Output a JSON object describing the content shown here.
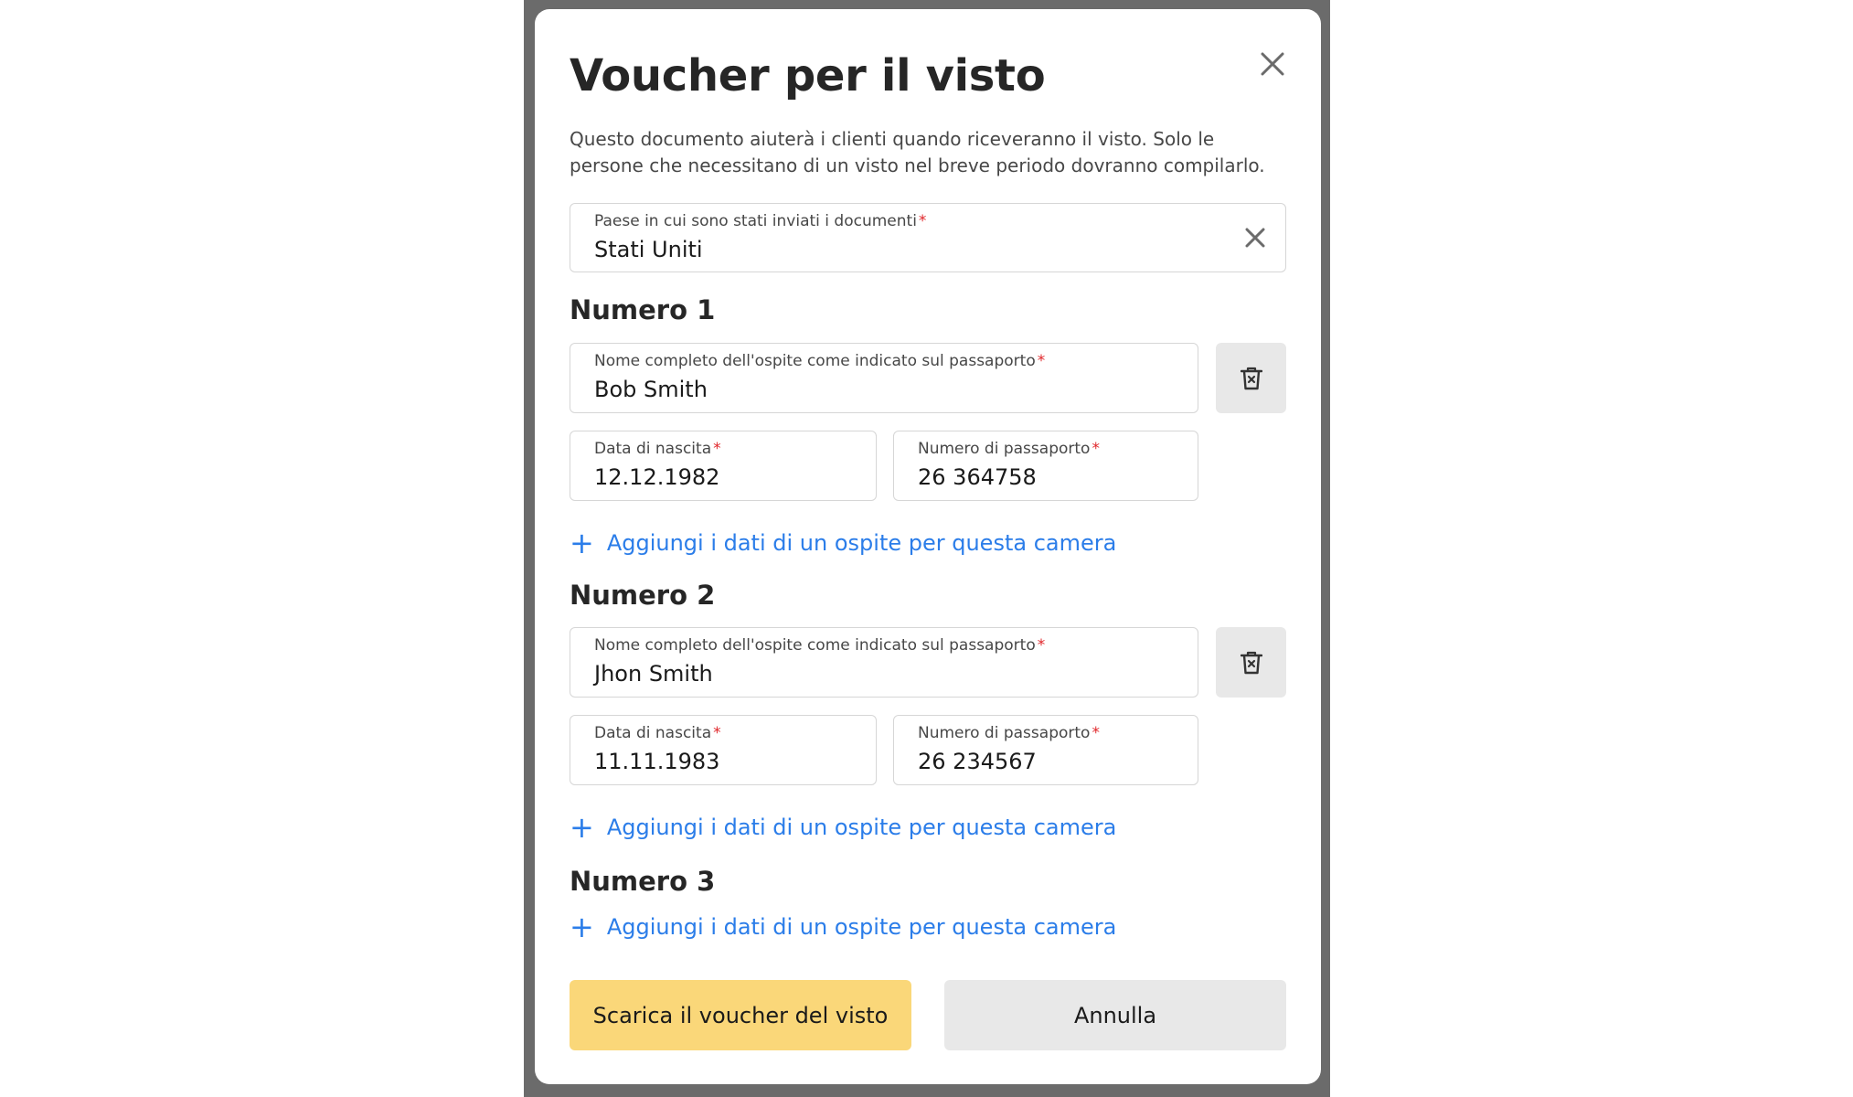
{
  "modal": {
    "title": "Voucher per il visto",
    "description": "Questo documento aiuterà i clienti quando riceveranno il visto. Solo le persone che necessitano di un visto nel breve periodo dovranno compilarlo.",
    "country_field": {
      "label": "Paese in cui sono stati inviati i documenti",
      "required_mark": "*",
      "value": "Stati Uniti"
    },
    "rooms": [
      {
        "title": "Numero 1",
        "guest": {
          "name_label": "Nome completo dell'ospite come indicato sul passaporto",
          "name_value": "Bob Smith",
          "dob_label": "Data di nascita",
          "dob_value": "12.12.1982",
          "passport_label": "Numero di passaporto",
          "passport_value": "26 364758"
        },
        "add_link": "Aggiungi i dati di un ospite per questa camera"
      },
      {
        "title": "Numero 2",
        "guest": {
          "name_label": "Nome completo dell'ospite come indicato sul passaporto",
          "name_value": "Jhon Smith",
          "dob_label": "Data di nascita",
          "dob_value": "11.11.1983",
          "passport_label": "Numero di passaporto",
          "passport_value": "26 234567"
        },
        "add_link": "Aggiungi i dati di un ospite per questa camera"
      },
      {
        "title": "Numero 3",
        "add_link": "Aggiungi i dati di un ospite per questa camera"
      }
    ],
    "buttons": {
      "primary": "Scarica il voucher del visto",
      "secondary": "Annulla"
    }
  },
  "icons": {
    "close": "close-icon",
    "clear": "clear-icon",
    "delete": "trash-icon",
    "add": "plus-icon"
  },
  "colors": {
    "accent": "#2b7de9",
    "primary_button": "#fad779",
    "required": "#e0262a",
    "backdrop": "#6b6b6b"
  }
}
